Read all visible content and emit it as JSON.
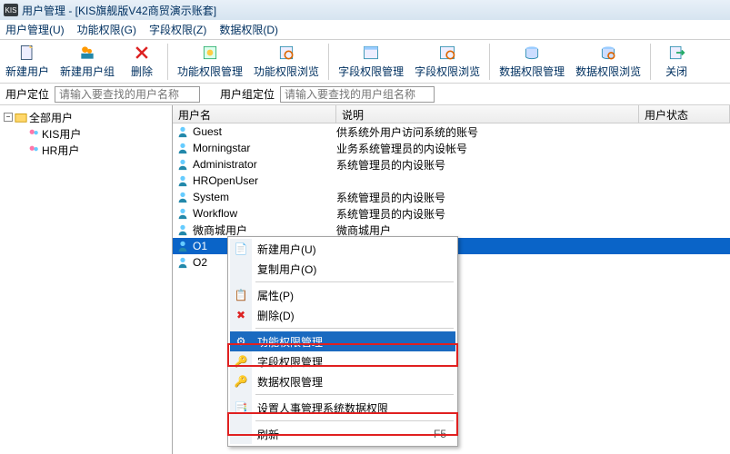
{
  "title": "用户管理 - [KIS旗舰版V42商贸演示账套]",
  "app_badge": "KIS",
  "menu": {
    "user_mgmt": "用户管理(U)",
    "func_perm": "功能权限(G)",
    "field_perm": "字段权限(Z)",
    "data_perm": "数据权限(D)"
  },
  "toolbar": {
    "new_user": "新建用户",
    "new_group": "新建用户组",
    "delete": "删除",
    "func_mgmt": "功能权限管理",
    "func_view": "功能权限浏览",
    "field_mgmt": "字段权限管理",
    "field_view": "字段权限浏览",
    "data_mgmt": "数据权限管理",
    "data_view": "数据权限浏览",
    "close": "关闭"
  },
  "locator": {
    "user_label": "用户定位",
    "user_ph": "请输入要查找的用户名称",
    "group_label": "用户组定位",
    "group_ph": "请输入要查找的用户组名称"
  },
  "tree": {
    "root": "全部用户",
    "kis": "KIS用户",
    "hr": "HR用户"
  },
  "grid": {
    "col_user": "用户名",
    "col_desc": "说明",
    "col_status": "用户状态",
    "rows": [
      {
        "user": "Guest",
        "desc": "供系统外用户访问系统的账号"
      },
      {
        "user": "Morningstar",
        "desc": "业务系统管理员的内设帐号"
      },
      {
        "user": "Administrator",
        "desc": "系统管理员的内设账号"
      },
      {
        "user": "HROpenUser",
        "desc": ""
      },
      {
        "user": "System",
        "desc": "系统管理员的内设账号"
      },
      {
        "user": "Workflow",
        "desc": "系统管理员的内设账号"
      },
      {
        "user": "微商城用户",
        "desc": "微商城用户"
      },
      {
        "user": "O1",
        "desc": ""
      },
      {
        "user": "O2",
        "desc": ""
      }
    ]
  },
  "ctx": {
    "new_user": "新建用户(U)",
    "copy_user": "复制用户(O)",
    "props": "属性(P)",
    "delete": "删除(D)",
    "func_mgmt": "功能权限管理",
    "field_mgmt": "字段权限管理",
    "data_mgmt": "数据权限管理",
    "hr_data": "设置人事管理系统数据权限",
    "refresh": "刷新",
    "refresh_sc": "F5"
  }
}
